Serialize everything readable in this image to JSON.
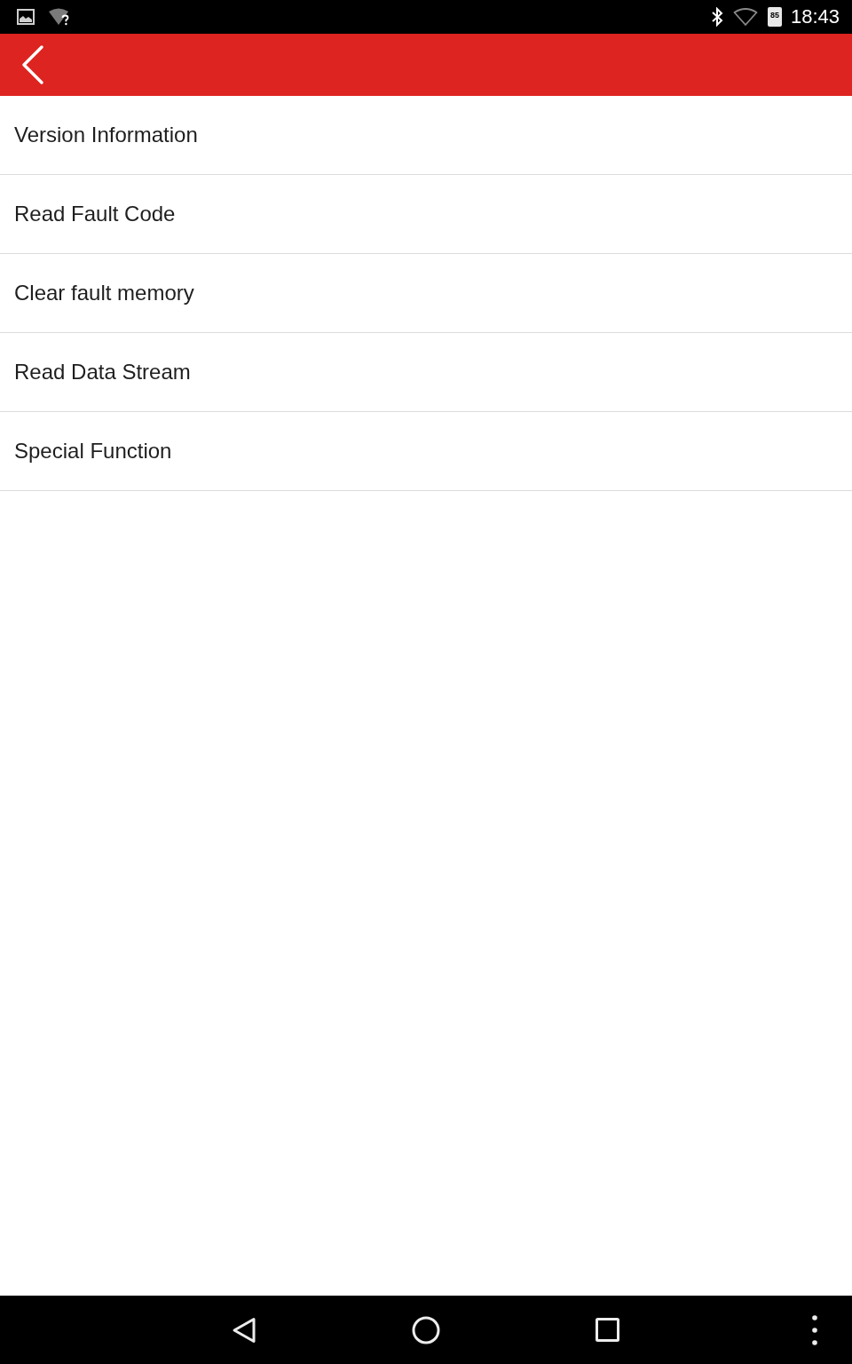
{
  "status_bar": {
    "battery": "85",
    "time": "18:43"
  },
  "menu_items": [
    {
      "label": "Version Information"
    },
    {
      "label": "Read Fault Code"
    },
    {
      "label": "Clear fault memory"
    },
    {
      "label": "Read Data Stream"
    },
    {
      "label": "Special Function"
    }
  ]
}
